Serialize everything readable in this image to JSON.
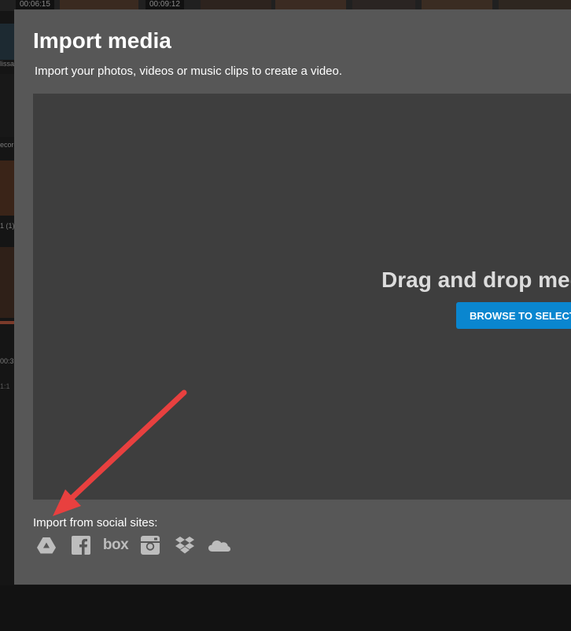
{
  "background": {
    "timestamps": [
      "00:06:15",
      "00:09:12"
    ],
    "side_fragments": [
      "lissa",
      "ecord",
      "1 (1)",
      "00:3",
      "1:1"
    ]
  },
  "modal": {
    "title": "Import media",
    "subtitle": "Import your photos, videos or music clips to create a video.",
    "dropzone": {
      "text": "Drag and drop media",
      "browse_label": "BROWSE TO SELECT"
    },
    "social": {
      "label": "Import from social sites:",
      "icons": [
        "google-drive-icon",
        "facebook-icon",
        "box-icon",
        "instagram-icon",
        "dropbox-icon",
        "onedrive-icon"
      ],
      "box_text": "box"
    }
  },
  "colors": {
    "modal_bg": "#575757",
    "dropzone_bg": "#3e3e3e",
    "accent": "#0a86cf",
    "annotation": "#e8403f",
    "icon": "#bdbdbd"
  }
}
